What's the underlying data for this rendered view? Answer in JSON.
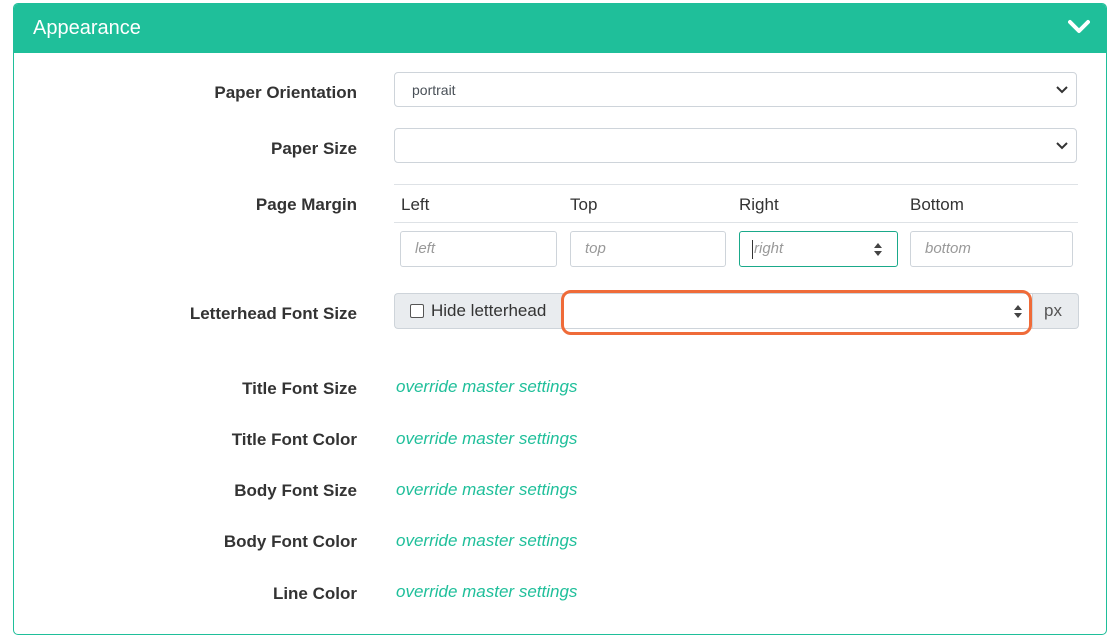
{
  "panel": {
    "title": "Appearance",
    "toggle_icon": "chevron-down-icon"
  },
  "fields": {
    "paper_orientation": {
      "label": "Paper Orientation",
      "value": "portrait"
    },
    "paper_size": {
      "label": "Paper Size",
      "value": ""
    },
    "page_margin": {
      "label": "Page Margin",
      "columns": [
        "Left",
        "Top",
        "Right",
        "Bottom"
      ],
      "placeholders": [
        "left",
        "top",
        "right",
        "bottom"
      ]
    },
    "letterhead_font_size": {
      "label": "Letterhead Font Size",
      "checkbox_label": "Hide letterhead",
      "unit": "px",
      "value": ""
    }
  },
  "overrides": [
    {
      "label": "Title Font Size",
      "link": "override master settings"
    },
    {
      "label": "Title Font Color",
      "link": "override master settings"
    },
    {
      "label": "Body Font Size",
      "link": "override master settings"
    },
    {
      "label": "Body Font Color",
      "link": "override master settings"
    },
    {
      "label": "Line Color",
      "link": "override master settings"
    }
  ],
  "colors": {
    "accent": "#1fbf9a",
    "highlight": "#ef6b39"
  }
}
